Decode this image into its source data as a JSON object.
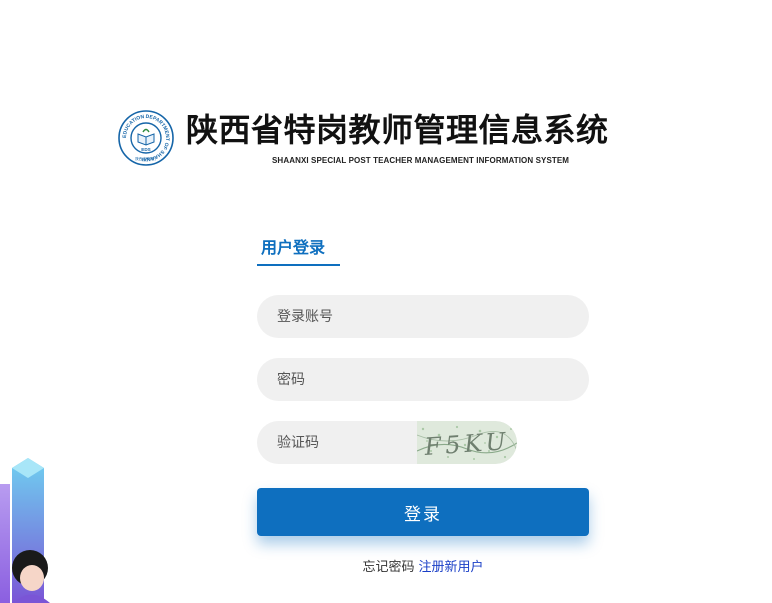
{
  "header": {
    "title": "陕西省特岗教师管理信息系统",
    "subtitle": "SHAANXI SPECIAL POST TEACHER MANAGEMENT INFORMATION SYSTEM",
    "logo": {
      "icon": "education-department-seal-icon",
      "ring_text": "EDUCATION DEPARTMENT OF SHAANXI",
      "center_text": "EDS",
      "bottom_text": "陕西省教育厅"
    }
  },
  "login": {
    "tab_label": "用户登录",
    "account_placeholder": "登录账号",
    "password_placeholder": "密码",
    "captcha_placeholder": "验证码",
    "captcha_text": "F5KU",
    "submit_label": "登录",
    "forgot_label": "忘记密码",
    "register_label": "注册新用户"
  },
  "colors": {
    "accent": "#0e6fbf",
    "field_background": "#f0f0f0",
    "register_link": "#1a3fc7"
  }
}
